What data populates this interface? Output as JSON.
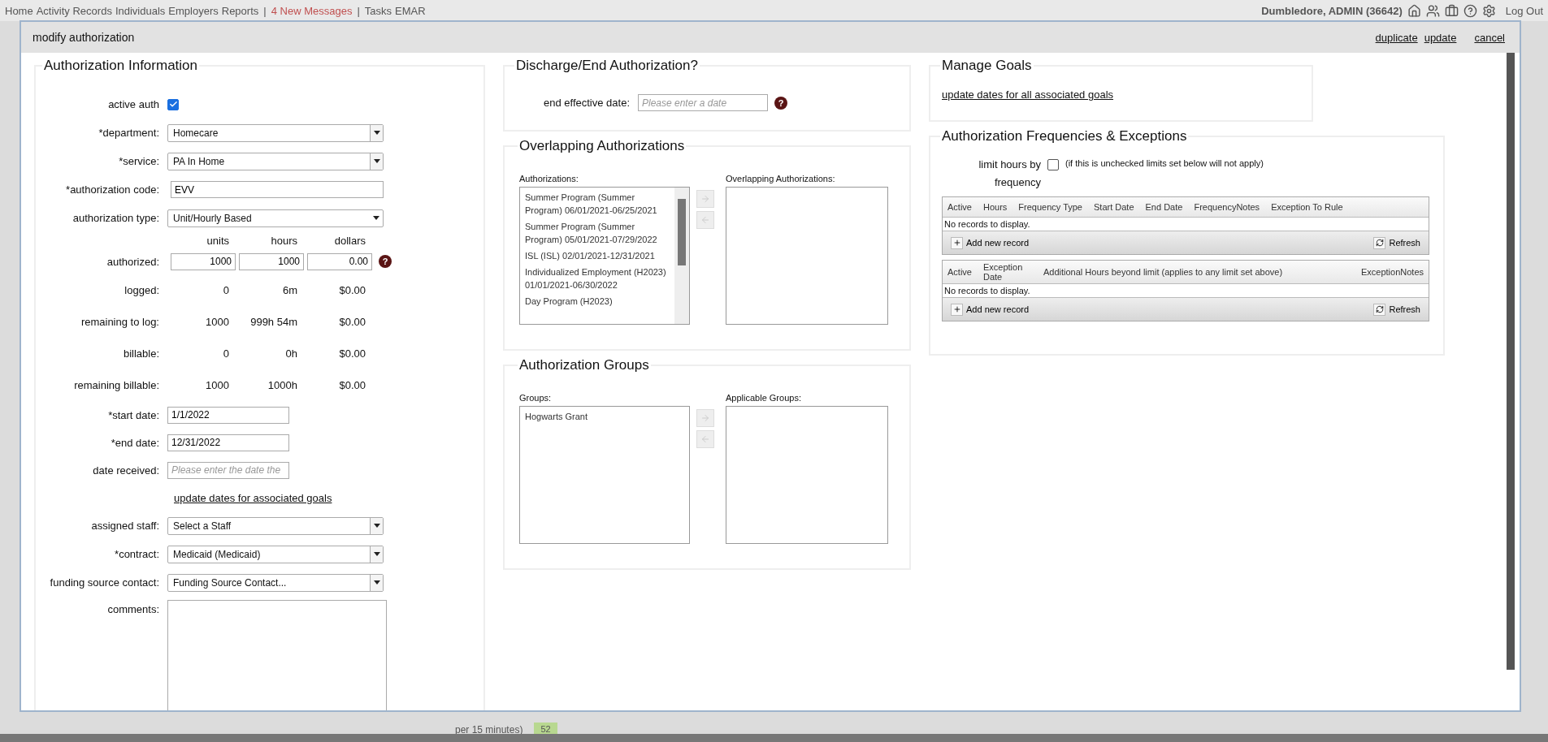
{
  "nav": {
    "links": [
      "Home",
      "Activity Records",
      "Individuals",
      "Employers",
      "Reports"
    ],
    "separator": "|",
    "messages": "4 New Messages",
    "extra_links": [
      "Tasks",
      "EMAR"
    ],
    "user": "Dumbledore, ADMIN (36642)",
    "logout": "Log Out"
  },
  "background": {
    "texts": [
      "per 15 minutes)"
    ],
    "badge": "52"
  },
  "dialog": {
    "title": "modify authorization",
    "actions": [
      "duplicate",
      "update",
      "cancel"
    ]
  },
  "auth_info": {
    "title": "Authorization Information",
    "rows": [
      {
        "kind": "checkbox",
        "label": "active auth",
        "checked": true
      },
      {
        "kind": "select",
        "label": "*department:",
        "value": "Homecare"
      },
      {
        "kind": "select",
        "label": "*service:",
        "value": "PA In Home"
      },
      {
        "kind": "text",
        "label": "*authorization code:",
        "value": "EVV"
      },
      {
        "kind": "dropdown",
        "label": "authorization type:",
        "value": "Unit/Hourly Based"
      },
      {
        "kind": "headers",
        "columns": [
          "units",
          "hours",
          "dollars"
        ]
      },
      {
        "kind": "amounts",
        "label": "authorized:",
        "values": [
          "1000",
          "1000",
          "0.00"
        ],
        "help": "?"
      },
      {
        "kind": "stats",
        "label": "logged:",
        "values": [
          "0",
          "6m",
          "$0.00"
        ]
      },
      {
        "kind": "stats",
        "label": "remaining to log:",
        "values": [
          "1000",
          "999h 54m",
          "$0.00"
        ]
      },
      {
        "kind": "stats",
        "label": "billable:",
        "values": [
          "0",
          "0h",
          "$0.00"
        ]
      },
      {
        "kind": "stats",
        "label": "remaining billable:",
        "values": [
          "1000",
          "1000h",
          "$0.00"
        ]
      },
      {
        "kind": "date",
        "label": "*start date:",
        "value": "1/1/2022"
      },
      {
        "kind": "date",
        "label": "*end date:",
        "value": "12/31/2022"
      },
      {
        "kind": "date",
        "label": "date received:",
        "placeholder": "Please enter the date the"
      },
      {
        "kind": "link",
        "text": "update dates for associated goals"
      },
      {
        "kind": "select",
        "label": "assigned staff:",
        "value": "Select a Staff"
      },
      {
        "kind": "select",
        "label": "*contract:",
        "value": "Medicaid (Medicaid)"
      },
      {
        "kind": "select",
        "label": "funding source contact:",
        "value": "Funding Source Contact..."
      },
      {
        "kind": "textarea",
        "label": "comments:"
      }
    ]
  },
  "discharge": {
    "title": "Discharge/End Authorization?",
    "label": "end effective date:",
    "placeholder": "Please enter a date",
    "help": "?"
  },
  "transfers": [
    {
      "title": "Overlapping Authorizations",
      "left_label": "Authorizations:",
      "right_label": "Overlapping Authorizations:",
      "items": [
        "Summer Program (Summer Program) 06/01/2021-06/25/2021",
        "Summer Program (Summer Program) 05/01/2021-07/29/2022",
        "ISL (ISL) 02/01/2021-12/31/2021",
        "Individualized Employment (H2023) 01/01/2021-06/30/2022",
        "Day Program (H2023)"
      ],
      "scrollable": true,
      "buttons_disabled": true
    },
    {
      "title": "Authorization Groups",
      "left_label": "Groups:",
      "right_label": "Applicable Groups:",
      "items": [
        "Hogwarts Grant"
      ],
      "scrollable": false,
      "buttons_disabled": true
    }
  ],
  "goals": {
    "title": "Manage Goals",
    "link": "update dates for all associated goals"
  },
  "frequencies": {
    "title": "Authorization Frequencies & Exceptions",
    "limit": {
      "label": "limit hours by frequency",
      "checked": false,
      "note": "(if this is unchecked limits set below will not apply)"
    },
    "tables": [
      {
        "columns": [
          "Active",
          "Hours",
          "Frequency Type",
          "Start Date",
          "End Date",
          "FrequencyNotes",
          "Exception To Rule"
        ],
        "empty": "No records to display.",
        "add": "Add new record",
        "refresh": "Refresh"
      },
      {
        "columns": [
          "Active",
          "Exception Date",
          "Additional Hours beyond limit (applies to any limit set above)",
          "ExceptionNotes"
        ],
        "empty": "No records to display.",
        "add": "Add new record",
        "refresh": "Refresh"
      }
    ]
  }
}
